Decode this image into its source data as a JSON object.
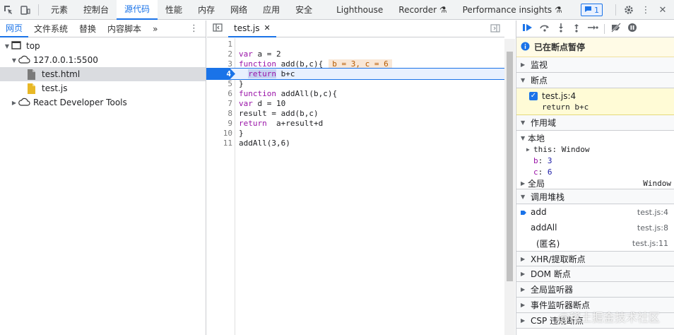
{
  "topbar": {
    "tabs": [
      "元素",
      "控制台",
      "源代码",
      "性能",
      "内存",
      "网络",
      "应用",
      "安全",
      "Lighthouse",
      "Recorder ⚗",
      "Performance insights ⚗"
    ],
    "active_tab": "源代码",
    "issues_count": "1"
  },
  "navigator": {
    "tabs": [
      "网页",
      "文件系统",
      "替换",
      "内容脚本"
    ],
    "more": "»",
    "tree": [
      {
        "label": "top",
        "icon": "frame-icon",
        "depth": 0,
        "expanded": true
      },
      {
        "label": "127.0.0.1:5500",
        "icon": "cloud-icon",
        "depth": 1,
        "expanded": true
      },
      {
        "label": "test.html",
        "icon": "html-file-icon",
        "depth": 2,
        "selected": true
      },
      {
        "label": "test.js",
        "icon": "js-file-icon",
        "depth": 2
      },
      {
        "label": "React Developer Tools",
        "icon": "cloud-icon",
        "depth": 1,
        "expanded": false
      }
    ]
  },
  "editor": {
    "file_tab": "test.js",
    "paused_line": 4,
    "inline_values": "b = 3, c = 6",
    "lines": [
      {
        "n": "1",
        "code": ""
      },
      {
        "n": "2",
        "code": "var a = 2"
      },
      {
        "n": "3",
        "code": "function add(b,c){"
      },
      {
        "n": "4",
        "code": "  return b+c"
      },
      {
        "n": "5",
        "code": "}"
      },
      {
        "n": "6",
        "code": "function addAll(b,c){"
      },
      {
        "n": "7",
        "code": "var d = 10"
      },
      {
        "n": "8",
        "code": "result = add(b,c)"
      },
      {
        "n": "9",
        "code": "return  a+result+d"
      },
      {
        "n": "10",
        "code": "}"
      },
      {
        "n": "11",
        "code": "addAll(3,6)"
      }
    ]
  },
  "debugger": {
    "paused_label": "已在断点暂停",
    "watch_label": "监视",
    "breakpoints_label": "断点",
    "breakpoint": {
      "location": "test.js:4",
      "code": "return b+c",
      "checked": true
    },
    "scope_label": "作用域",
    "local_label": "本地",
    "scope_vars": [
      {
        "name": "this",
        "value": "Window",
        "expandable": true
      },
      {
        "name": "b",
        "value": "3"
      },
      {
        "name": "c",
        "value": "6"
      }
    ],
    "global_label": "全局",
    "global_value": "Window",
    "callstack_label": "调用堆栈",
    "callstack": [
      {
        "fn": "add",
        "loc": "test.js:4",
        "current": true
      },
      {
        "fn": "addAll",
        "loc": "test.js:8"
      },
      {
        "fn": "(匿名)",
        "loc": "test.js:11"
      }
    ],
    "more_sections": [
      "XHR/提取断点",
      "DOM 断点",
      "全局监听器",
      "事件监听器断点",
      "CSP 违规断点"
    ]
  },
  "watermark": "@稀土掘金技术社区",
  "colors": {
    "accent": "#1a73e8",
    "paused_bg": "#fffbe6",
    "keyword": "#9a14a8",
    "inline_value_bg": "#f9e7d6"
  }
}
